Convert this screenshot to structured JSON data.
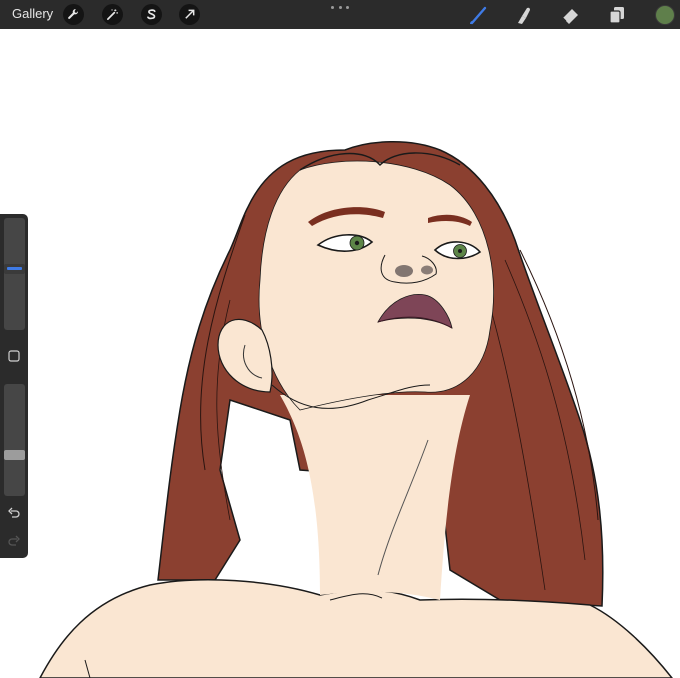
{
  "topbar": {
    "gallery_label": "Gallery",
    "left_tools": [
      "wrench-icon",
      "magic-wand-icon",
      "selection-icon",
      "transform-arrow-icon"
    ],
    "right_tools": [
      "brush-icon",
      "smudge-icon",
      "eraser-icon",
      "layers-icon"
    ],
    "active_tool": "brush-icon",
    "current_color": "#5f7f4b"
  },
  "sidebar": {
    "brush_size_level": 0.55,
    "opacity_level": 0.35
  },
  "colors": {
    "ui_dark": "#2b2b2b",
    "accent_blue": "#3f7be6",
    "hair": "#8b4030",
    "skin": "#fae6d2",
    "lips": "#7e4557",
    "eyes": "#5d8548"
  }
}
